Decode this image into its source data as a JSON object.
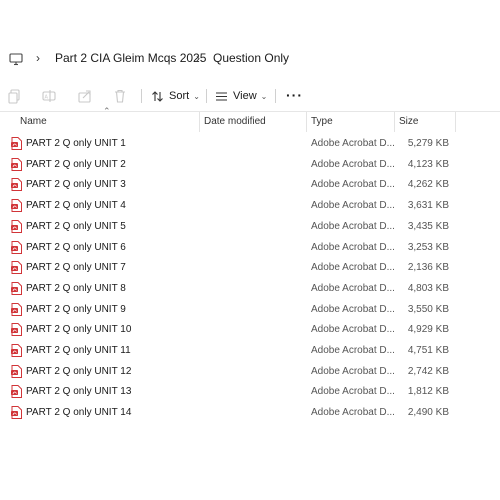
{
  "breadcrumb": {
    "icon": "pc-monitor-icon",
    "items": [
      "Part 2 CIA Gleim Mcqs 2025",
      "Question Only"
    ]
  },
  "toolbar": {
    "sort_label": "Sort",
    "view_label": "View",
    "more_label": "···"
  },
  "columns": {
    "name": "Name",
    "date_modified": "Date modified",
    "type": "Type",
    "size": "Size"
  },
  "files": [
    {
      "name": "PART 2 Q only  UNIT 1",
      "type": "Adobe Acrobat D...",
      "size": "5,279 KB"
    },
    {
      "name": "PART 2 Q only  UNIT 2",
      "type": "Adobe Acrobat D...",
      "size": "4,123 KB"
    },
    {
      "name": "PART 2 Q only  UNIT 3",
      "type": "Adobe Acrobat D...",
      "size": "4,262 KB"
    },
    {
      "name": "PART 2 Q only  UNIT 4",
      "type": "Adobe Acrobat D...",
      "size": "3,631 KB"
    },
    {
      "name": "PART 2 Q only  UNIT 5",
      "type": "Adobe Acrobat D...",
      "size": "3,435 KB"
    },
    {
      "name": "PART 2 Q only  UNIT 6",
      "type": "Adobe Acrobat D...",
      "size": "3,253 KB"
    },
    {
      "name": "PART 2 Q only  UNIT 7",
      "type": "Adobe Acrobat D...",
      "size": "2,136 KB"
    },
    {
      "name": "PART 2 Q only  UNIT 8",
      "type": "Adobe Acrobat D...",
      "size": "4,803 KB"
    },
    {
      "name": "PART 2 Q only  UNIT 9",
      "type": "Adobe Acrobat D...",
      "size": "3,550 KB"
    },
    {
      "name": "PART 2 Q only  UNIT 10",
      "type": "Adobe Acrobat D...",
      "size": "4,929 KB"
    },
    {
      "name": "PART 2 Q only  UNIT 11",
      "type": "Adobe Acrobat D...",
      "size": "4,751 KB"
    },
    {
      "name": "PART 2 Q only  UNIT 12",
      "type": "Adobe Acrobat D...",
      "size": "2,742 KB"
    },
    {
      "name": "PART 2 Q only  UNIT 13",
      "type": "Adobe Acrobat D...",
      "size": "1,812 KB"
    },
    {
      "name": "PART 2 Q only  UNIT 14",
      "type": "Adobe Acrobat D...",
      "size": "2,490 KB"
    }
  ],
  "colors": {
    "pdf_icon": "#d13438",
    "divider": "#e6e6e6"
  }
}
